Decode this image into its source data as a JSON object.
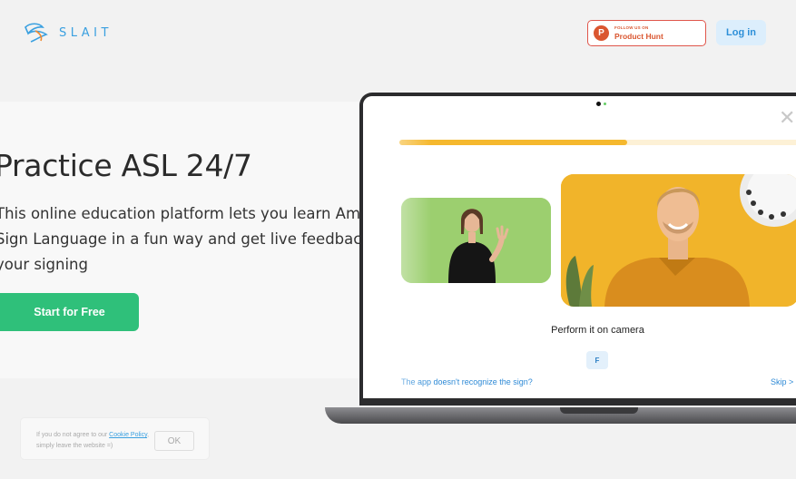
{
  "header": {
    "brand": "SLAIT",
    "product_hunt": {
      "small": "FOLLOW US ON",
      "big": "Product Hunt",
      "letter": "P"
    },
    "login_label": "Log in"
  },
  "hero": {
    "title": "Practice ASL 24/7",
    "desc_lines": [
      "This online education platform lets you learn American",
      "Sign Language in a fun way and get live feedback on",
      "your signing"
    ],
    "cta_label": "Start for Free"
  },
  "app": {
    "progress": 0.57,
    "prompt": "Perform it on camera",
    "letter": "F",
    "help_link": "The app doesn't recognize the sign?",
    "skip_label": "Skip >"
  },
  "cookie": {
    "text_before": "If you do not agree to our ",
    "link": "Cookie Policy",
    "text_after": ", simply leave the website =)",
    "ok_label": "OK"
  },
  "colors": {
    "accent_green": "#2fc07a",
    "accent_blue": "#2d8fd8",
    "product_hunt": "#da5630",
    "progress": "#f5b82e"
  }
}
